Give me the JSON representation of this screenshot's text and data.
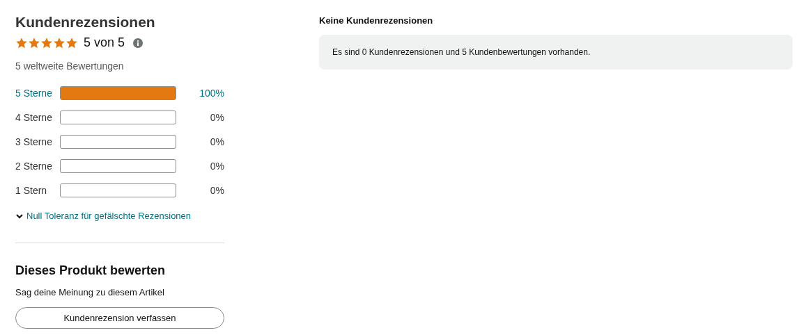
{
  "summary": {
    "title": "Kundenrezensionen",
    "stars": 5,
    "rating_text": "5 von 5",
    "total_text": "5 weltweite Bewertungen"
  },
  "histogram": [
    {
      "label": "5 Sterne",
      "level": 1,
      "percent": "100%",
      "linked": true
    },
    {
      "label": "4 Sterne",
      "level": 0,
      "percent": "0%",
      "linked": false
    },
    {
      "label": "3 Sterne",
      "level": 0,
      "percent": "0%",
      "linked": false
    },
    {
      "label": "2 Sterne",
      "level": 0,
      "percent": "0%",
      "linked": false
    },
    {
      "label": "1 Stern",
      "level": 0,
      "percent": "0%",
      "linked": false
    }
  ],
  "disclosure": {
    "label": "Null Toleranz für gefälschte Rezensionen",
    "expanded": false
  },
  "review_prompt": {
    "title": "Dieses Produkt bewerten",
    "text": "Sag deine Meinung zu diesem Artikel",
    "button": "Kundenrezension verfassen"
  },
  "reviews": {
    "title": "Keine Kundenrezensionen",
    "message": "Es sind 0 Kundenrezensionen und 5 Kundenbewertungen vorhanden."
  }
}
